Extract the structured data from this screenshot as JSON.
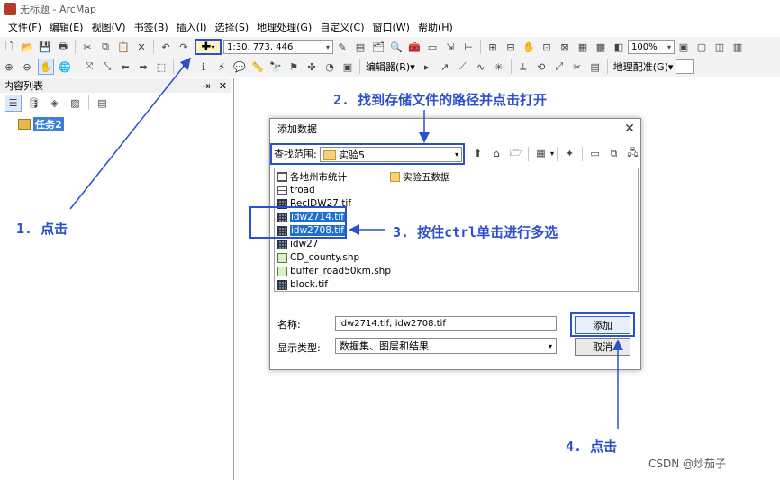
{
  "window": {
    "title": "无标题 - ArcMap"
  },
  "menu": [
    "文件(F)",
    "编辑(E)",
    "视图(V)",
    "书签(B)",
    "插入(I)",
    "选择(S)",
    "地理处理(G)",
    "自定义(C)",
    "窗口(W)",
    "帮助(H)"
  ],
  "toolbar": {
    "scale": "1:30, 773, 446",
    "zoom": "100%",
    "editor_label": "编辑器(R)▾",
    "georef_label": "地理配准(G)▾"
  },
  "toc": {
    "title": "内容列表",
    "pin": "⇥",
    "close": "✕",
    "layer_name": "任务2"
  },
  "dialog": {
    "title": "添加数据",
    "close": "✕",
    "look_in_label": "查找范围:",
    "look_in_value": "实验5",
    "files": [
      {
        "name": "各地州市统计",
        "type": "table"
      },
      {
        "name": "troad",
        "type": "table"
      },
      {
        "name": "RecIDW27.tif",
        "type": "raster"
      },
      {
        "name": "idw2714.tif",
        "type": "raster",
        "selected": true
      },
      {
        "name": "idw2708.tif",
        "type": "raster",
        "selected": true
      },
      {
        "name": "idw27",
        "type": "raster"
      },
      {
        "name": "CD_county.shp",
        "type": "shapefile"
      },
      {
        "name": "buffer_road50km.shp",
        "type": "shapefile"
      },
      {
        "name": "block.tif",
        "type": "raster"
      },
      {
        "name": "实验五数据",
        "type": "folder"
      }
    ],
    "name_label": "名称:",
    "name_value": "idw2714.tif; idw2708.tif",
    "type_label": "显示类型:",
    "type_value": "数据集、图层和结果",
    "add_button": "添加",
    "cancel_button": "取消"
  },
  "annotations": {
    "step1": "1. 点击",
    "step2": "2. 找到存储文件的路径并点击打开",
    "step3": "3. 按住ctrl单击进行多选",
    "step4": "4. 点击"
  },
  "watermark": "CSDN @炒茄子",
  "colors": {
    "annotation": "#2c4fd0",
    "selection": "#1f6fd0"
  }
}
